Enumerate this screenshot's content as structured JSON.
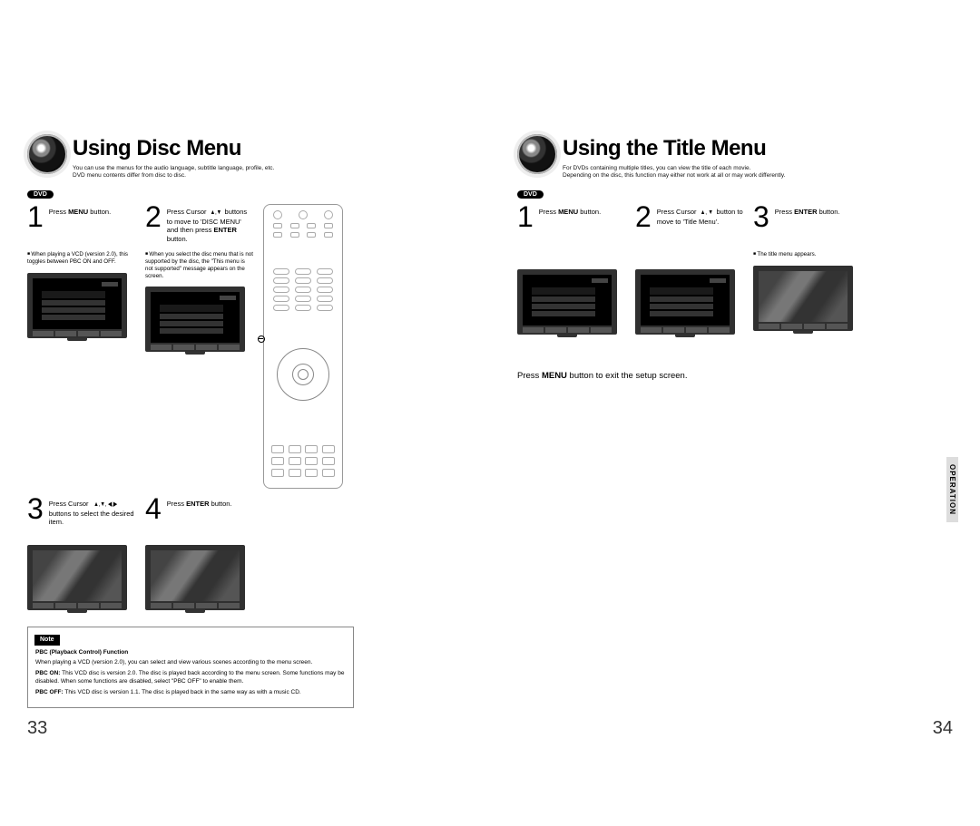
{
  "left": {
    "title": "Using Disc Menu",
    "sub1": "You can use the menus for the audio language, subtitle language, profile, etc.",
    "sub2": "DVD menu contents differ from disc to disc.",
    "badge": "DVD",
    "step1": {
      "num": "1",
      "text_a": "Press ",
      "text_b": "MENU",
      "text_c": " button.",
      "note": "When playing a VCD (version 2.0), this toggles between PBC ON and OFF."
    },
    "step2": {
      "num": "2",
      "text_a": "Press Cursor ",
      "arrows": "▲,▼",
      "text_b": " buttons to move to 'DISC MENU' and then press ",
      "bold": "ENTER",
      "text_c": " button.",
      "note": "When you select the disc menu that is not supported by the disc, the \"This menu is not supported\" message appears on the screen."
    },
    "step3": {
      "num": "3",
      "text_a": "Press Cursor ",
      "arrows": "▲,▼, ◀,▶",
      "text_b": " buttons to select the desired item."
    },
    "step4": {
      "num": "4",
      "text_a": "Press ",
      "bold": "ENTER",
      "text_c": " button."
    },
    "note": {
      "badge": "Note",
      "pbc_title": "PBC (Playback Control) Function",
      "line1": "When playing a VCD (version 2.0), you can select and view various scenes according to the menu screen.",
      "pbc_on_lbl": "PBC ON:",
      "pbc_on": " This VCD disc is version 2.0. The disc is played back according to the menu screen. Some functions may be disabled. When some functions are disabled, select \"PBC OFF\" to enable them.",
      "pbc_off_lbl": "PBC OFF:",
      "pbc_off": " This VCD disc is version 1.1. The disc is played back in the same way as with a music CD."
    },
    "page_num": "33"
  },
  "right": {
    "title": "Using the Title Menu",
    "sub1": "For DVDs containing multiple titles, you can view the title of each movie.",
    "sub2": "Depending on the disc, this function may either not work at all or may work differently.",
    "badge": "DVD",
    "step1": {
      "num": "1",
      "text_a": "Press ",
      "bold": "MENU",
      "text_c": " button."
    },
    "step2": {
      "num": "2",
      "text_a": "Press Cursor ",
      "arrows": "▲, ▼",
      "text_b": " button to move to 'Title Menu'."
    },
    "step3": {
      "num": "3",
      "text_a": "Press ",
      "bold": "ENTER",
      "text_c": " button.",
      "note": "The title menu appears."
    },
    "footer": {
      "a": "Press ",
      "b": "MENU",
      "c": " button to exit the setup screen."
    },
    "side": "OPERATION",
    "page_num": "34"
  }
}
